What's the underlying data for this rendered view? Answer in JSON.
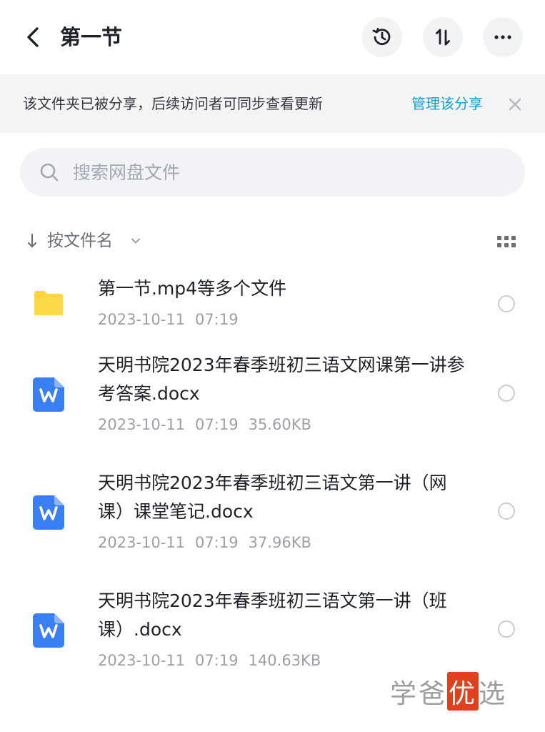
{
  "header": {
    "title": "第一节",
    "icons": [
      "back-arrow-icon",
      "history-icon",
      "sort-icon",
      "more-icon"
    ]
  },
  "share_banner": {
    "text": "该文件夹已被分享，后续访问者可同步查看更新",
    "link": "管理该分享",
    "close_icon": "close-icon"
  },
  "search": {
    "placeholder": "搜索网盘文件",
    "value": ""
  },
  "sort": {
    "label": "按文件名"
  },
  "files": [
    {
      "type": "folder",
      "name": "第一节.mp4等多个文件",
      "date": "2023-10-11",
      "time": "07:19",
      "size": ""
    },
    {
      "type": "docx",
      "name": "天明书院2023年春季班初三语文网课第一讲参考答案.docx",
      "date": "2023-10-11",
      "time": "07:19",
      "size": "35.60KB"
    },
    {
      "type": "docx",
      "name": "天明书院2023年春季班初三语文第一讲（网课）课堂笔记.docx",
      "date": "2023-10-11",
      "time": "07:19",
      "size": "37.96KB"
    },
    {
      "type": "docx",
      "name": "天明书院2023年春季班初三语文第一讲（班课）.docx",
      "date": "2023-10-11",
      "time": "07:19",
      "size": "140.63KB"
    }
  ],
  "watermark": {
    "part1": "学爸",
    "highlight": "优",
    "part2": "选"
  },
  "colors": {
    "accent": "#1aa0c8",
    "folder": "#fcd43c",
    "word": "#3a7ff2",
    "watermark_highlight": "#e0411d"
  }
}
